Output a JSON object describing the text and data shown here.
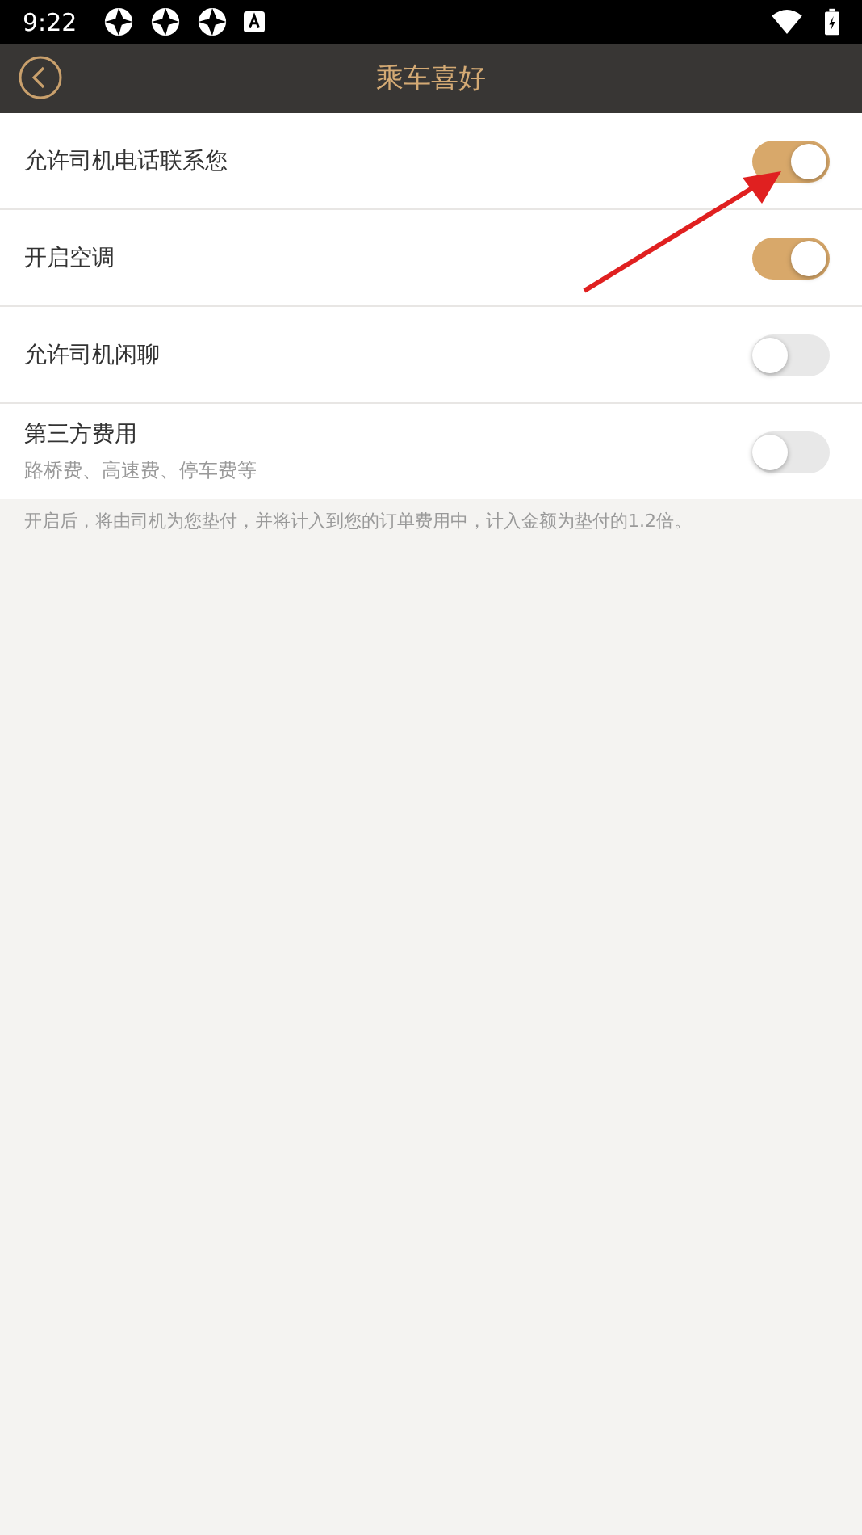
{
  "status_bar": {
    "time": "9:22"
  },
  "header": {
    "title": "乘车喜好"
  },
  "settings": [
    {
      "label": "允许司机电话联系您",
      "on": true
    },
    {
      "label": "开启空调",
      "on": true
    },
    {
      "label": "允许司机闲聊",
      "on": false
    },
    {
      "label": "第三方费用",
      "subtitle": "路桥费、高速费、停车费等",
      "on": false
    }
  ],
  "note": "开启后，将由司机为您垫付，并将计入到您的订单费用中，计入金额为垫付的1.2倍。"
}
